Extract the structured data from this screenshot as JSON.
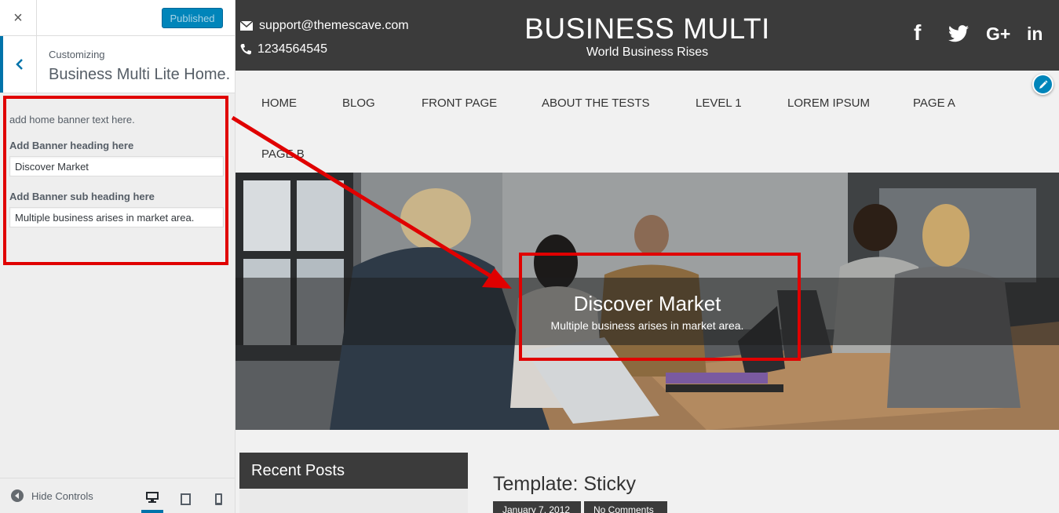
{
  "customizer": {
    "close_label": "×",
    "publish_label": "Published",
    "customizing_label": "Customizing",
    "section_title": "Business Multi Lite Home...",
    "description": "add home banner text here.",
    "heading_label": "Add Banner heading here",
    "heading_value": "Discover Market",
    "subheading_label": "Add Banner sub heading here",
    "subheading_value": "Multiple business arises in market area.",
    "hide_controls_label": "Hide Controls"
  },
  "site": {
    "email": "support@themescave.com",
    "phone": "1234564545",
    "title": "BUSINESS MULTI",
    "tagline": "World Business Rises",
    "social": {
      "facebook": "f",
      "google_plus": "G+",
      "linkedin": "in"
    },
    "nav": [
      "HOME",
      "BLOG",
      "FRONT PAGE",
      "ABOUT THE TESTS",
      "LEVEL 1",
      "LOREM IPSUM",
      "PAGE A",
      "PAGE B"
    ],
    "banner": {
      "heading": "Discover Market",
      "subheading": "Multiple business arises in market area."
    },
    "sidebar_widget_title": "Recent Posts",
    "post": {
      "title": "Template: Sticky",
      "date": "January 7, 2012",
      "comments": "No Comments"
    }
  },
  "colors": {
    "accent": "#0085ba",
    "annotation": "#e00000",
    "header_bg": "#3b3b3b"
  }
}
